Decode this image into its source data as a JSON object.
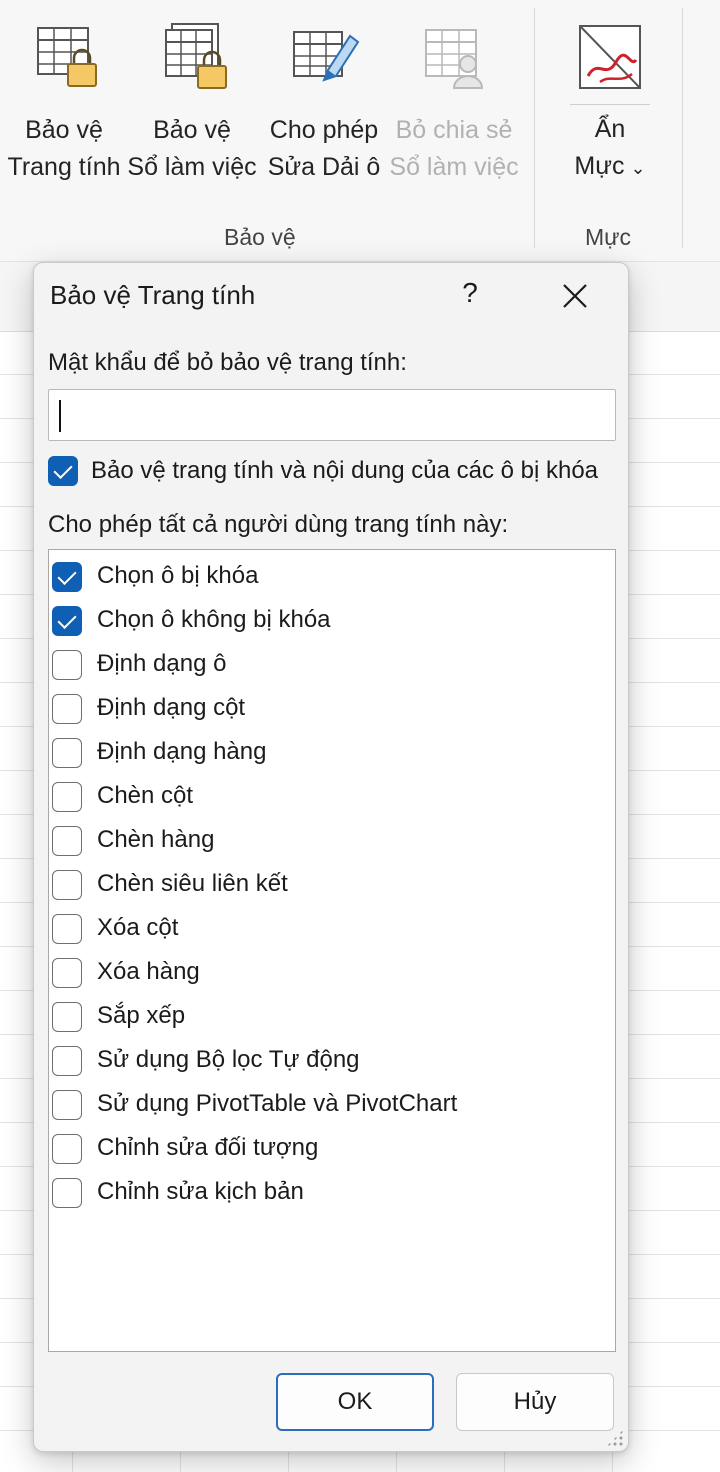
{
  "ribbon": {
    "buttons": [
      {
        "line1": "Bảo vệ",
        "line2": "Trang tính",
        "icon": "protect-sheet-icon",
        "enabled": true
      },
      {
        "line1": "Bảo vệ",
        "line2": "Sổ làm việc",
        "icon": "protect-workbook-icon",
        "enabled": true
      },
      {
        "line1": "Cho phép",
        "line2": "Sửa Dải ô",
        "icon": "allow-edit-ranges-icon",
        "enabled": true
      },
      {
        "line1": "Bỏ chia sẻ",
        "line2": "Sổ làm việc",
        "icon": "unshare-workbook-icon",
        "enabled": false
      }
    ],
    "protect_group_label": "Bảo vệ",
    "ink_button": {
      "line1": "Ẩn",
      "line2": "Mực",
      "icon": "hide-ink-icon",
      "chevron": "chevron-down-icon"
    },
    "ink_group_label": "Mực"
  },
  "dialog": {
    "title": "Bảo vệ Trang tính",
    "help": "?",
    "password_label": "Mật khẩu để bỏ bảo vệ trang tính:",
    "password_value": "",
    "protect_label": "Bảo vệ trang tính và nội dung của các ô bị khóa",
    "protect_checked": true,
    "allow_label": "Cho phép tất cả người dùng trang tính này:",
    "permissions": [
      {
        "label": "Chọn ô bị khóa",
        "checked": true
      },
      {
        "label": "Chọn ô không bị khóa",
        "checked": true
      },
      {
        "label": "Định dạng ô",
        "checked": false
      },
      {
        "label": "Định dạng cột",
        "checked": false
      },
      {
        "label": "Định dạng hàng",
        "checked": false
      },
      {
        "label": "Chèn cột",
        "checked": false
      },
      {
        "label": "Chèn hàng",
        "checked": false
      },
      {
        "label": "Chèn siêu liên kết",
        "checked": false
      },
      {
        "label": "Xóa cột",
        "checked": false
      },
      {
        "label": "Xóa hàng",
        "checked": false
      },
      {
        "label": "Sắp xếp",
        "checked": false
      },
      {
        "label": "Sử dụng Bộ lọc Tự động",
        "checked": false
      },
      {
        "label": "Sử dụng PivotTable và PivotChart",
        "checked": false
      },
      {
        "label": "Chỉnh sửa đối tượng",
        "checked": false
      },
      {
        "label": "Chỉnh sửa kịch bản",
        "checked": false
      }
    ],
    "ok_label": "OK",
    "cancel_label": "Hủy"
  },
  "colors": {
    "accent": "#0f5fb5",
    "lock": "#f4c865",
    "ink_red": "#d0202a"
  }
}
